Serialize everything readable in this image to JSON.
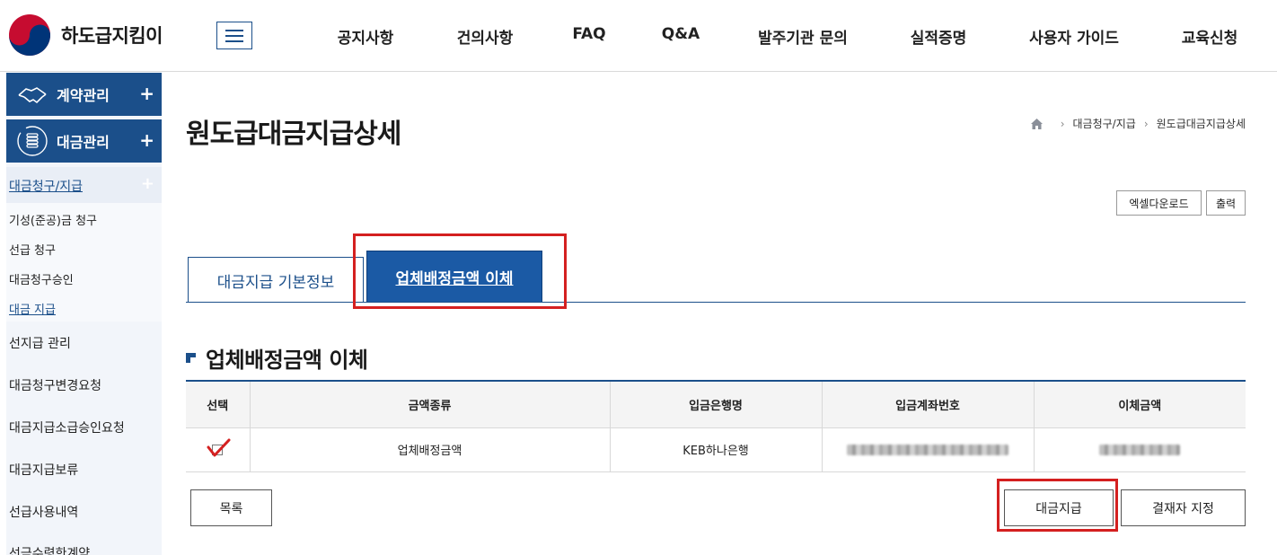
{
  "header": {
    "logo_text": "하도급지킴이",
    "nav": [
      {
        "label": "공지사항"
      },
      {
        "label": "건의사항"
      },
      {
        "label": "FAQ"
      },
      {
        "label": "Q&A"
      },
      {
        "label": "발주기관 문의"
      },
      {
        "label": "실적증명"
      },
      {
        "label": "사용자 가이드"
      },
      {
        "label": "교육신청"
      }
    ]
  },
  "sidebar": {
    "categories": [
      {
        "label": "계약관리",
        "icon": "handshake-icon",
        "expand": "+"
      },
      {
        "label": "대금관리",
        "icon": "coins-icon",
        "expand": "+"
      }
    ],
    "group": {
      "label": "대금청구/지급",
      "expand": "+"
    },
    "group_items": [
      {
        "label": "기성(준공)금 청구"
      },
      {
        "label": "선급 청구"
      },
      {
        "label": "대금청구승인"
      },
      {
        "label": "대금 지급"
      }
    ],
    "items": [
      {
        "label": "선지급 관리"
      },
      {
        "label": "대금청구변경요청"
      },
      {
        "label": "대금지급소급승인요청"
      },
      {
        "label": "대금지급보류"
      },
      {
        "label": "선급사용내역"
      },
      {
        "label": "선금수령한계약"
      }
    ]
  },
  "main": {
    "title": "원도급대금지급상세",
    "breadcrumb": [
      "대금청구/지급",
      "원도급대금지급상세"
    ],
    "excel_button": "엑셀다운로드",
    "print_button": "출력",
    "tabs": [
      {
        "label": "대금지급 기본정보",
        "active": false
      },
      {
        "label": "업체배정금액 이체",
        "active": true
      }
    ],
    "section_title": "업체배정금액 이체",
    "table": {
      "headers": [
        "선택",
        "금액종류",
        "입금은행명",
        "입금계좌번호",
        "이체금액"
      ],
      "rows": [
        {
          "checked": true,
          "amount_type": "업체배정금액",
          "bank": "KEB하나은행"
        }
      ]
    },
    "list_button": "목록",
    "pay_button": "대금지급",
    "approver_button": "결재자 지정"
  },
  "colors": {
    "primary": "#1b4f8a",
    "tab_active": "#1b5aa5",
    "highlight": "#d42020",
    "sidebar_bg": "#f2f5fa"
  }
}
